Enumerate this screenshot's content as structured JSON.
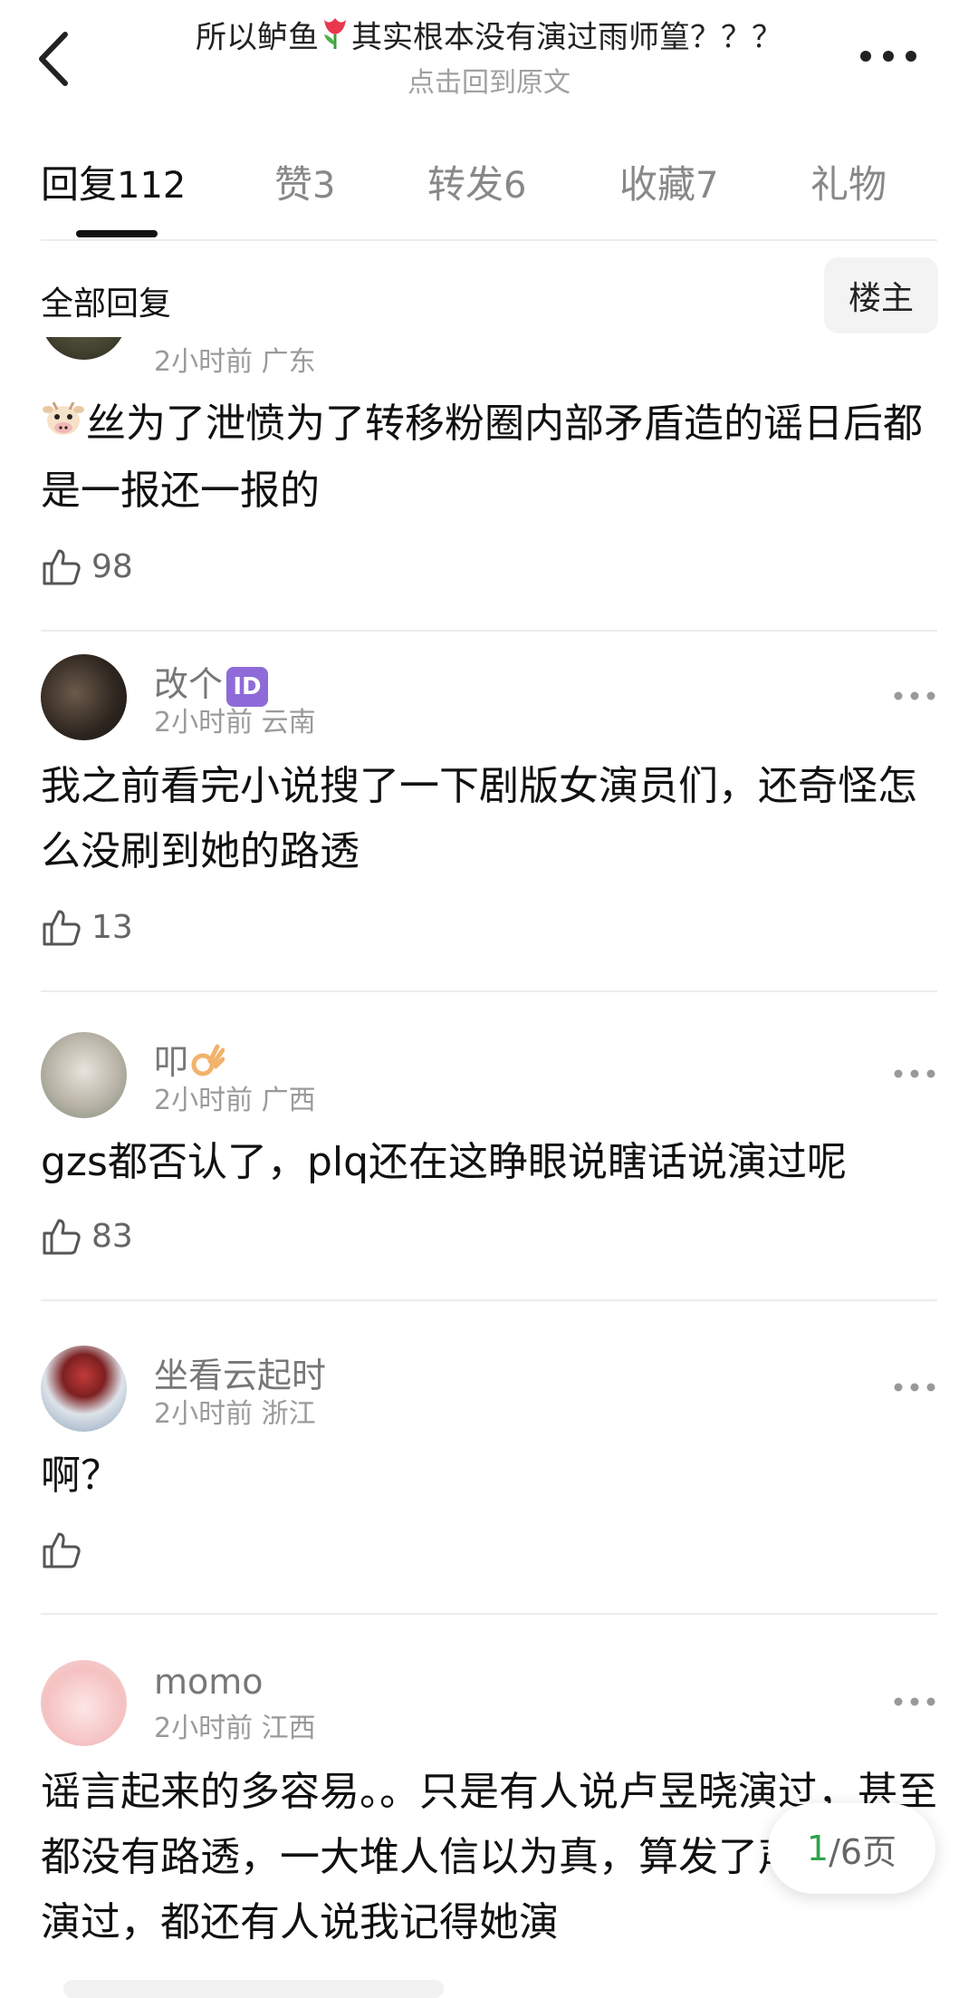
{
  "header": {
    "title_prefix": "所以鲈鱼",
    "title_suffix": "其实根本没有演过雨师篁？？？",
    "subtitle": "点击回到原文"
  },
  "tabs": [
    {
      "label": "回复",
      "count": "112"
    },
    {
      "label": "赞",
      "count": "3"
    },
    {
      "label": "转发",
      "count": "6"
    },
    {
      "label": "收藏",
      "count": "7"
    },
    {
      "label": "礼物",
      "count": ""
    }
  ],
  "filter": {
    "label": "全部回复",
    "op_button": "楼主"
  },
  "comments": [
    {
      "username": "",
      "meta": "2小时前 广东",
      "text": "丝为了泄愤为了转移粉圈内部矛盾造的谣日后都是一报还一报的",
      "likes": "98"
    },
    {
      "username": "改个",
      "meta": "2小时前 云南",
      "text": "我之前看完小说搜了一下剧版女演员们，还奇怪怎么没刷到她的路透",
      "likes": "13"
    },
    {
      "username": "叩",
      "meta": "2小时前 广西",
      "text": "gzs都否认了，plq还在这睁眼说瞎话说演过呢",
      "likes": "83"
    },
    {
      "username": "坐看云起时",
      "meta": "2小时前 浙江",
      "text": "啊？",
      "likes": ""
    },
    {
      "username": "momo",
      "meta": "2小时前 江西",
      "text": "谣言起来的多容易。。只是有人说卢昱晓演过，甚至都没有路透，一大堆人信以为真，算发了声明说没演过，都还有人说我记得她演",
      "likes": ""
    }
  ],
  "pagination": {
    "current": "1",
    "rest": "/6页"
  },
  "badges": {
    "id_badge": "ID"
  }
}
